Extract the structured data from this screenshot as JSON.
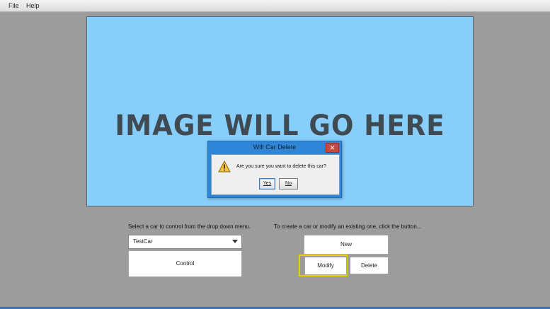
{
  "menu": {
    "items": [
      "File",
      "Help"
    ]
  },
  "image_panel": {
    "text": "IMAGE WILL GO HERE"
  },
  "dialog": {
    "title": "Wifi Car Delete",
    "close_label": "✕",
    "message": "Are you sure you want to delete this car?",
    "yes_label": "Yes",
    "no_label": "No",
    "icon": "warning-icon"
  },
  "control_section": {
    "caption": "Select a car to control from the drop down menu.",
    "selected_car": "TestCar",
    "control_label": "Control"
  },
  "edit_section": {
    "caption": "To create a car or modify an existing one, click the button...",
    "new_label": "New",
    "modify_label": "Modify",
    "delete_label": "Delete"
  },
  "colors": {
    "background": "#9c9c9c",
    "image_panel": "#87cefa",
    "dialog_frame": "#2f86d6",
    "highlight": "#e8d000"
  }
}
